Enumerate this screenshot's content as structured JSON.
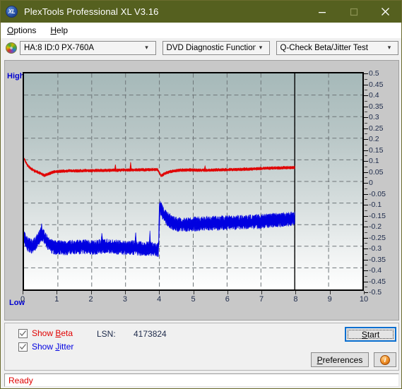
{
  "window": {
    "title": "PlexTools Professional XL V3.16",
    "icon": "XL",
    "buttons": {
      "minimize": "minimize-icon",
      "maximize": "maximize-icon",
      "close": "close-icon"
    },
    "titlebar_color": "#55601f"
  },
  "menu": [
    {
      "label": "Options",
      "mnemonic": "O"
    },
    {
      "label": "Help",
      "mnemonic": "H"
    }
  ],
  "toolbar": {
    "disc_icon": "disc-icon",
    "drive": {
      "value": "HA:8 ID:0  PX-760A",
      "arrow": "chevron-down-icon"
    },
    "function": {
      "value": "DVD Diagnostic Functions",
      "arrow": "chevron-down-icon"
    },
    "test": {
      "value": "Q-Check Beta/Jitter Test",
      "arrow": "chevron-down-icon"
    }
  },
  "chart_labels": {
    "high": "High",
    "low": "Low"
  },
  "controls": {
    "show_beta": {
      "label": "Show Beta",
      "mnemonic": "B",
      "checked": true,
      "color": "#e00000"
    },
    "show_jitter": {
      "label": "Show Jitter",
      "mnemonic": "J",
      "checked": true,
      "color": "#0000e0"
    },
    "lsn_label": "LSN:",
    "lsn_value": "4173824",
    "start_button": {
      "label": "Start",
      "mnemonic": "S",
      "focused": true
    },
    "preferences_button": {
      "label": "Preferences",
      "mnemonic": "P"
    },
    "info_button": {
      "icon": "info-icon",
      "glyph": "i"
    }
  },
  "status": {
    "text": "Ready",
    "color": "#e00000"
  },
  "chart_data": {
    "type": "line",
    "title": "Q-Check Beta/Jitter Test",
    "xlabel": "",
    "ylabel": "",
    "xlim": [
      0,
      10
    ],
    "ylim": [
      -0.5,
      0.5
    ],
    "grid": true,
    "legend": "checkbox-toggles",
    "x_ticks": [
      0,
      1,
      2,
      3,
      4,
      5,
      6,
      7,
      8,
      9,
      10
    ],
    "y_ticks": [
      0.5,
      0.45,
      0.4,
      0.35,
      0.3,
      0.25,
      0.2,
      0.15,
      0.1,
      0.05,
      0,
      -0.05,
      -0.1,
      -0.15,
      -0.2,
      -0.25,
      -0.3,
      -0.35,
      -0.4,
      -0.45,
      -0.5
    ],
    "data_end_marker_x": 8,
    "annotations": [
      {
        "type": "vline",
        "x": 8,
        "color": "#000000",
        "note": "end-of-data marker"
      },
      {
        "type": "vline",
        "x": 4,
        "color": "#000000",
        "note": "layer-break transition"
      }
    ],
    "series": [
      {
        "name": "Beta",
        "color": "#e00000",
        "x": [
          0.0,
          0.1,
          0.2,
          0.3,
          0.4,
          0.5,
          0.6,
          0.7,
          0.8,
          0.9,
          1.0,
          1.2,
          1.4,
          1.6,
          1.8,
          2.0,
          2.2,
          2.4,
          2.6,
          2.8,
          3.0,
          3.2,
          3.4,
          3.6,
          3.8,
          3.95,
          4.05,
          4.2,
          4.4,
          4.6,
          4.8,
          5.0,
          5.2,
          5.4,
          5.6,
          5.8,
          6.0,
          6.2,
          6.4,
          6.6,
          6.8,
          7.0,
          7.2,
          7.4,
          7.6,
          7.8,
          8.0
        ],
        "y": [
          0.105,
          0.075,
          0.06,
          0.05,
          0.043,
          0.036,
          0.028,
          0.033,
          0.04,
          0.045,
          0.046,
          0.048,
          0.049,
          0.049,
          0.05,
          0.05,
          0.051,
          0.051,
          0.052,
          0.052,
          0.053,
          0.053,
          0.054,
          0.054,
          0.055,
          0.054,
          0.026,
          0.04,
          0.048,
          0.052,
          0.053,
          0.053,
          0.052,
          0.052,
          0.053,
          0.054,
          0.054,
          0.055,
          0.056,
          0.057,
          0.058,
          0.06,
          0.061,
          0.062,
          0.063,
          0.064,
          0.064
        ],
        "noise": 0.006,
        "spikes": [
          {
            "x": 2.7,
            "y": 0.08
          },
          {
            "x": 3.15,
            "y": 0.092
          },
          {
            "x": 5.35,
            "y": 0.074
          }
        ]
      },
      {
        "name": "Jitter",
        "color": "#0000e0",
        "x": [
          0.0,
          0.1,
          0.2,
          0.3,
          0.4,
          0.5,
          0.6,
          0.7,
          0.8,
          0.9,
          1.0,
          1.2,
          1.4,
          1.6,
          1.8,
          2.0,
          2.2,
          2.4,
          2.6,
          2.8,
          3.0,
          3.2,
          3.4,
          3.6,
          3.8,
          3.93,
          3.97,
          4.02,
          4.08,
          4.15,
          4.25,
          4.4,
          4.6,
          4.8,
          5.0,
          5.2,
          5.4,
          5.6,
          5.8,
          6.0,
          6.2,
          6.4,
          6.6,
          6.8,
          7.0,
          7.2,
          7.4,
          7.6,
          7.8,
          8.0
        ],
        "y": [
          -0.255,
          -0.29,
          -0.3,
          -0.295,
          -0.27,
          -0.245,
          -0.258,
          -0.285,
          -0.3,
          -0.305,
          -0.305,
          -0.308,
          -0.305,
          -0.303,
          -0.302,
          -0.305,
          -0.303,
          -0.3,
          -0.302,
          -0.305,
          -0.308,
          -0.305,
          -0.31,
          -0.312,
          -0.312,
          -0.315,
          -0.318,
          -0.115,
          -0.14,
          -0.16,
          -0.175,
          -0.195,
          -0.2,
          -0.2,
          -0.198,
          -0.196,
          -0.194,
          -0.193,
          -0.192,
          -0.19,
          -0.19,
          -0.189,
          -0.188,
          -0.187,
          -0.185,
          -0.182,
          -0.18,
          -0.178,
          -0.175,
          -0.172
        ],
        "noise": 0.03,
        "spikes": [
          {
            "x": 0.52,
            "y": -0.195
          },
          {
            "x": 2.3,
            "y": -0.235
          },
          {
            "x": 3.3,
            "y": -0.23
          },
          {
            "x": 3.72,
            "y": -0.228
          },
          {
            "x": 4.0,
            "y": -0.1
          },
          {
            "x": 7.3,
            "y": -0.15
          }
        ]
      }
    ]
  }
}
